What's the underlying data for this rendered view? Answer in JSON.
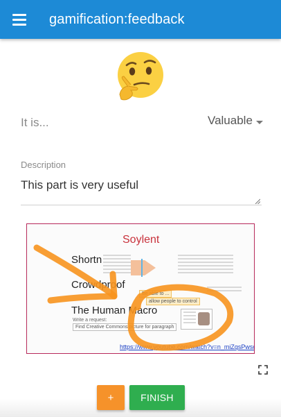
{
  "app_bar": {
    "title": "gamification:feedback",
    "menu_icon": "hamburger-menu-icon",
    "color": "#1d8ad6"
  },
  "emoji": {
    "icon": "thinking-face-icon"
  },
  "rating": {
    "label": "It is...",
    "selected": "Valuable"
  },
  "description": {
    "label": "Description",
    "value": "This part is very useful"
  },
  "screenshot": {
    "title": "Soylent",
    "rows": [
      "Shortn",
      "Crowdproof",
      "The Human Macro"
    ],
    "write_request": "Write a request:",
    "request_box": "Find Creative Commons picture for paragraph",
    "side_box_1": "Be able to ... ",
    "side_box_2": "allow people to control",
    "link": "https://www.youtube.com/watch?v=n_miZqsPwsc",
    "annotation_color": "#f7931e",
    "border_color": "#b7285a"
  },
  "actions": {
    "plus_label": "+",
    "finish_label": "FINISH",
    "plus_color": "#f6922a",
    "finish_color": "#2fae4f",
    "fullscreen_icon": "fullscreen-icon"
  }
}
